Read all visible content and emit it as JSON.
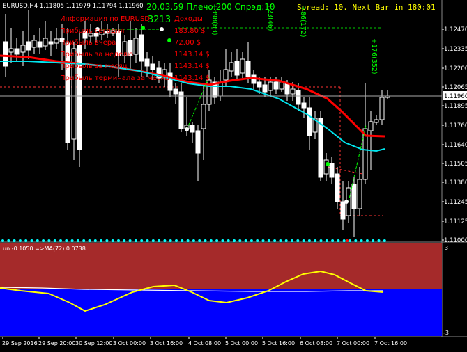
{
  "window": {
    "symbol_line": "EURUSD,H4  1.11805 1.11979 1.11794 1.11960"
  },
  "header": {
    "top_green": "20.03.59 Плечо:200 Спрэд:10",
    "spread_label": "Spread: 10.  Next Bar in 180:01",
    "account_number": "3213"
  },
  "info_panel": {
    "lines": [
      {
        "label": "Информация по EURUSD",
        "value": "Доходы"
      },
      {
        "label": "Прибыль сегодня",
        "value": "183.80 $"
      },
      {
        "label": "Прибыль вчера",
        "value": "72.00 $"
      },
      {
        "label": "Прибыль за неделю",
        "value": "1143.14 $"
      },
      {
        "label": "Прибыль за месяц",
        "value": "1143.14 $"
      },
      {
        "label": "Прибыль терминала за месяц",
        "value": "1143.14 $"
      }
    ]
  },
  "trade_labels": [
    {
      "text": "+398(83)"
    },
    {
      "text": "+23(46)"
    },
    {
      "text": "+86(172)"
    },
    {
      "text": "+176(352)"
    }
  ],
  "price_scale": [
    "1.12470",
    "1.12335",
    "1.12200",
    "1.12065",
    "1.11960",
    "1.11895",
    "1.11760",
    "1.11640",
    "1.11505",
    "1.11380",
    "1.11245",
    "1.11125",
    "1.11000"
  ],
  "current_price": "1.11960",
  "time_scale": [
    "29 Sep 2016",
    "29 Sep 20:00",
    "30 Sep 12:00",
    "3 Oct 00:00",
    "3 Oct 16:00",
    "4 Oct 08:00",
    "5 Oct 00:00",
    "5 Oct 16:00",
    "6 Oct 08:00",
    "7 Oct 00:00",
    "7 Oct 16:00"
  ],
  "indicator": {
    "label": "un -0.1050  =>MA(72) 0.0738",
    "scale_top": "3",
    "scale_bottom": "-3"
  },
  "colors": {
    "bg": "#000000",
    "up_candle": "#000000",
    "candle_outline": "#ffffff",
    "down_candle": "#ffffff",
    "ma_red": "#ff0000",
    "ma_cyan": "#00e5ee",
    "indicator_pos_bg": "#a52a2a",
    "indicator_neg_bg": "#0000ff",
    "osc_yellow": "#ffff00",
    "osc_white": "#ffffff",
    "profit_text": "#ff0000",
    "green_text": "#00ff00",
    "spread_text": "#ffff00",
    "dots": "#00ffff"
  }
}
